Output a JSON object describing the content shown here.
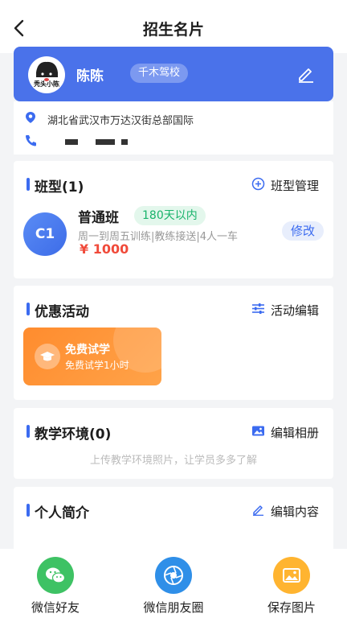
{
  "nav": {
    "title": "招生名片"
  },
  "profile": {
    "name": "陈陈",
    "school": "千木驾校",
    "avatar_text": "秃头小陈"
  },
  "info": {
    "address": "湖北省武汉市万达汉街总部国际"
  },
  "class_section": {
    "title": "班型(1)",
    "action": "班型管理",
    "item": {
      "badge": "C1",
      "name": "普通班",
      "tag": "180天以内",
      "desc": "周一到周五训练|教练接送|4人一车",
      "price": "¥ 1000",
      "modify": "修改"
    }
  },
  "promo_section": {
    "title": "优惠活动",
    "action": "活动编辑",
    "card": {
      "title": "免费试学",
      "subtitle": "免费试学1小时"
    }
  },
  "env_section": {
    "title": "教学环境(0)",
    "action": "编辑相册",
    "hint": "上传教学环境照片，让学员多多了解"
  },
  "bio_section": {
    "title": "个人简介",
    "action": "编辑内容"
  },
  "share": {
    "wechat_friend": "微信好友",
    "moments": "微信朋友圈",
    "save_image": "保存图片"
  },
  "colors": {
    "primary": "#4a72ea",
    "accent_blue": "#3b6bf0",
    "price_red": "#f04a3a",
    "tag_green": "#19b36b",
    "promo_orange": "#ff8c2e",
    "wechat_green": "#3ec264",
    "moments_blue": "#2f8fe8",
    "save_orange": "#ffb430"
  },
  "icons": [
    "back-icon",
    "edit-icon",
    "location-icon",
    "phone-icon",
    "add-circle-icon",
    "sliders-icon",
    "image-icon",
    "pencil-icon",
    "graduation-cap-icon",
    "wechat-icon",
    "moments-icon",
    "picture-icon"
  ]
}
